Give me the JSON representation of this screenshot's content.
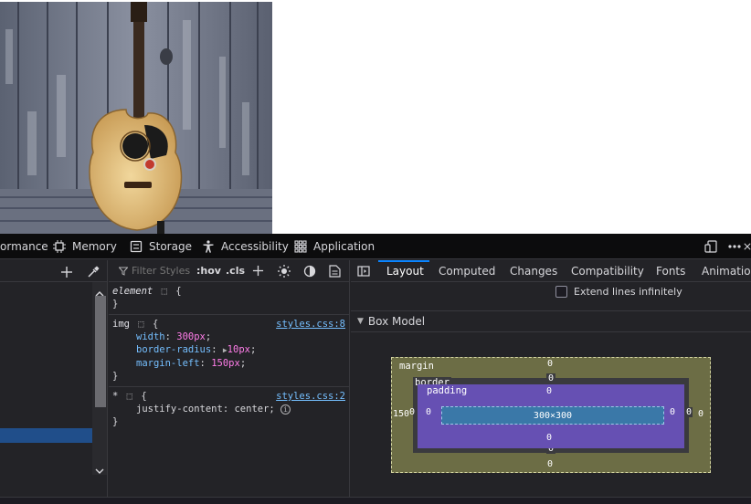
{
  "devtools": {
    "tabs": [
      {
        "label": "ormance",
        "icon": "performance-icon"
      },
      {
        "label": "Memory",
        "icon": "memory-icon"
      },
      {
        "label": "Storage",
        "icon": "storage-icon"
      },
      {
        "label": "Accessibility",
        "icon": "accessibility-icon"
      },
      {
        "label": "Application",
        "icon": "application-icon"
      }
    ],
    "filter_placeholder": "Filter Styles",
    "hov_label": ":hov",
    "cls_label": ".cls"
  },
  "styles": {
    "rules": [
      {
        "selector": "element",
        "open": "{",
        "close": "}",
        "source": "",
        "decls": []
      },
      {
        "selector": "img",
        "open": "{",
        "close": "}",
        "source": "styles.css:8",
        "decls": [
          {
            "prop": "width",
            "value": "300px"
          },
          {
            "prop": "border-radius",
            "value": "10px"
          },
          {
            "prop": "margin-left",
            "value": "150px"
          }
        ]
      },
      {
        "selector": "*",
        "open": "{",
        "close": "}",
        "source": "styles.css:2",
        "decls": [
          {
            "prop": "justify-content",
            "value": "center"
          }
        ]
      }
    ]
  },
  "layout": {
    "tabs": [
      "Layout",
      "Computed",
      "Changes",
      "Compatibility",
      "Fonts",
      "Animation"
    ],
    "active_tab": "Layout",
    "extend_lines_label": "Extend lines infinitely",
    "box_model_title": "Box Model",
    "box_model": {
      "margin_label": "margin",
      "border_label": "border",
      "padding_label": "padding",
      "margin": {
        "top": "0",
        "right": "0",
        "bottom": "0",
        "left": "150"
      },
      "border": {
        "top": "0",
        "right": "0",
        "bottom": "0",
        "left": "0"
      },
      "padding": {
        "top": "0",
        "right": "0",
        "bottom": "0",
        "left": "0"
      },
      "content": "300×300"
    }
  }
}
